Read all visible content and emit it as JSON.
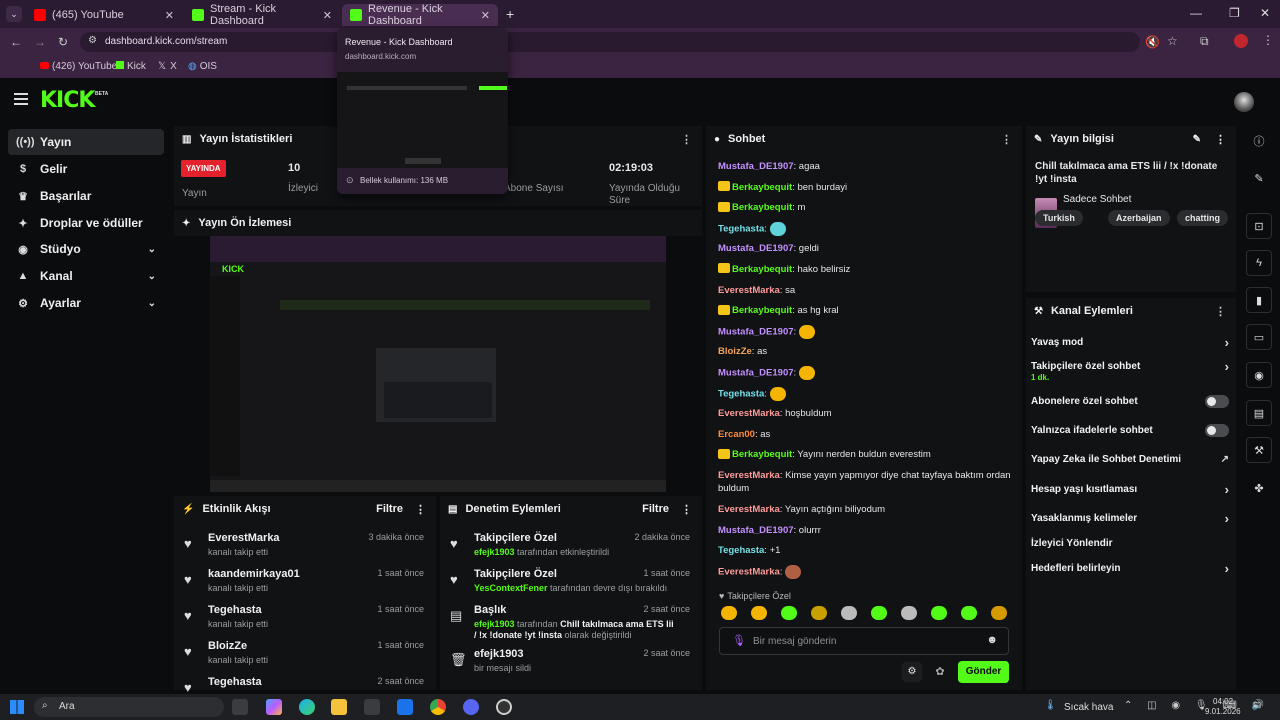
{
  "browser": {
    "tabs": [
      {
        "label": "(465) YouTube",
        "active": false
      },
      {
        "label": "Stream - Kick Dashboard",
        "active": false
      },
      {
        "label": "Revenue - Kick Dashboard",
        "active": true
      }
    ],
    "url": "dashboard.kick.com/stream",
    "bookmarks": [
      "(426) YouTube",
      "Kick",
      "X",
      "OIS"
    ],
    "tooltip": {
      "title": "Revenue - Kick Dashboard",
      "domain": "dashboard.kick.com",
      "memory": "Bellek kullanımı: 136 MB"
    }
  },
  "header": {
    "logo": "KICK",
    "beta": "BETA"
  },
  "sidebar": {
    "items": [
      {
        "label": "Yayın",
        "icon": "broadcast-icon",
        "glyph": "((•))",
        "expandable": false
      },
      {
        "label": "Gelir",
        "icon": "dollar-icon",
        "glyph": "$",
        "expandable": false
      },
      {
        "label": "Başarılar",
        "icon": "trophy-icon",
        "glyph": "♛",
        "expandable": false
      },
      {
        "label": "Droplar ve ödüller",
        "icon": "gift-icon",
        "glyph": "✦",
        "expandable": false
      },
      {
        "label": "Stüdyo",
        "icon": "studio-icon",
        "glyph": "◉",
        "expandable": true
      },
      {
        "label": "Kanal",
        "icon": "channel-icon",
        "glyph": "▲",
        "expandable": true
      },
      {
        "label": "Ayarlar",
        "icon": "settings-icon",
        "glyph": "⚙",
        "expandable": true
      }
    ]
  },
  "stats": {
    "title": "Yayın İstatistikleri",
    "live_badge": "YAYINDA",
    "live_label": "Yayın",
    "viewers_value": "10",
    "viewers_label": "İzleyici",
    "subs_label": "Abone Sayısı",
    "duration_value": "02:19:03",
    "duration_label": "Yayında Olduğu Süre"
  },
  "preview": {
    "title": "Yayın Ön İzlemesi"
  },
  "activity": {
    "title": "Etkinlik Akışı",
    "filter": "Filtre",
    "items": [
      {
        "name": "EverestMarka",
        "sub": "kanalı takip etti",
        "time": "3 dakika önce"
      },
      {
        "name": "kaandemirkaya01",
        "sub": "kanalı takip etti",
        "time": "1 saat önce"
      },
      {
        "name": "Tegehasta",
        "sub": "kanalı takip etti",
        "time": "1 saat önce"
      },
      {
        "name": "BloizZe",
        "sub": "kanalı takip etti",
        "time": "1 saat önce"
      },
      {
        "name": "Tegehasta",
        "sub": "",
        "time": "2 saat önce"
      }
    ]
  },
  "moderation": {
    "title": "Denetim Eylemleri",
    "filter": "Filtre",
    "items": [
      {
        "name": "Takipçilere Özel",
        "user": "efejk1903",
        "rest": " tarafından etkinleştirildi",
        "time": "2 dakika önce"
      },
      {
        "name": "Takipçilere Özel",
        "user": "YesContextFener",
        "rest": " tarafından devre dışı bırakıldı",
        "time": "1 saat önce"
      },
      {
        "name": "Başlık",
        "user": "efejk1903",
        "rest": " tarafından ",
        "title_bold": "Chill takılmaca ama ETS lii / !x !donate !yt !insta",
        "rest2": " olarak değiştirildi",
        "time": "2 saat önce"
      },
      {
        "name": "efejk1903",
        "user": "",
        "rest": "bir mesajı sildi",
        "time": "2 saat önce"
      }
    ]
  },
  "chat": {
    "title": "Sohbet",
    "messages": [
      {
        "user": "Mustafa_DE1907",
        "color": "#c490ff",
        "crown": false,
        "text": "agaa"
      },
      {
        "user": "Berkaybequit",
        "color": "#53fc18",
        "crown": true,
        "text": "ben burdayi"
      },
      {
        "user": "Berkaybequit",
        "color": "#53fc18",
        "crown": true,
        "text": "m"
      },
      {
        "user": "Tegehasta",
        "color": "#74e0e8",
        "crown": false,
        "text": "",
        "emote": "#5fd3d9"
      },
      {
        "user": "Mustafa_DE1907",
        "color": "#c490ff",
        "crown": false,
        "text": "geldi"
      },
      {
        "user": "Berkaybequit",
        "color": "#53fc18",
        "crown": true,
        "text": "hako belirsiz"
      },
      {
        "user": "EverestMarka",
        "color": "#ff9b9b",
        "crown": false,
        "text": "sa"
      },
      {
        "user": "Berkaybequit",
        "color": "#53fc18",
        "crown": true,
        "text": "as hg kral"
      },
      {
        "user": "Mustafa_DE1907",
        "color": "#c490ff",
        "crown": false,
        "text": "",
        "emote": "#f5b400"
      },
      {
        "user": "BloizZe",
        "color": "#f5a35c",
        "crown": false,
        "text": "as"
      },
      {
        "user": "Mustafa_DE1907",
        "color": "#c490ff",
        "crown": false,
        "text": "",
        "emote": "#f5b400"
      },
      {
        "user": "Tegehasta",
        "color": "#74e0e8",
        "crown": false,
        "text": "",
        "emote": "#f5b400"
      },
      {
        "user": "EverestMarka",
        "color": "#ff9b9b",
        "crown": false,
        "text": "hoşbuldum"
      },
      {
        "user": "Ercan00",
        "color": "#ff8a3d",
        "crown": false,
        "text": "as"
      },
      {
        "user": "Berkaybequit",
        "color": "#53fc18",
        "crown": true,
        "text": "Yayını nerden buldun everestim"
      },
      {
        "user": "EverestMarka",
        "color": "#ff9b9b",
        "crown": false,
        "text": "Kimse yayın yapmıyor diye chat tayfaya baktım ordan buldum"
      },
      {
        "user": "EverestMarka",
        "color": "#ff9b9b",
        "crown": false,
        "text": "Yayın açtığını biliyodum"
      },
      {
        "user": "Mustafa_DE1907",
        "color": "#c490ff",
        "crown": false,
        "text": "olurrr"
      },
      {
        "user": "Tegehasta",
        "color": "#74e0e8",
        "crown": false,
        "text": "+1"
      },
      {
        "user": "EverestMarka",
        "color": "#ff9b9b",
        "crown": false,
        "text": "",
        "emote": "#b06040"
      }
    ],
    "mode_label": "Takipçilere Özel",
    "input_placeholder": "Bir mesaj gönderin",
    "send_label": "Gönder"
  },
  "stream_info": {
    "title": "Yayın bilgisi",
    "stream_title": "Chill takılmaca ama ETS lii / !x !donate !yt !insta",
    "category": "Sadece Sohbet",
    "tags": [
      "Turkish",
      "Azerbaijan",
      "chatting"
    ]
  },
  "channel_actions": {
    "title": "Kanal Eylemleri",
    "rows": [
      {
        "label": "Yavaş mod",
        "type": "arrow"
      },
      {
        "label": "Takipçilere özel sohbet",
        "sub": "1 dk.",
        "type": "arrow"
      },
      {
        "label": "Abonelere özel sohbet",
        "type": "toggle"
      },
      {
        "label": "Yalnızca ifadelerle sohbet",
        "type": "toggle"
      },
      {
        "label": "Yapay Zeka ile Sohbet Denetimi",
        "type": "external"
      },
      {
        "label": "Hesap yaşı kısıtlaması",
        "type": "arrow"
      },
      {
        "label": "Yasaklanmış kelimeler",
        "type": "arrow"
      },
      {
        "label": "İzleyici Yönlendir",
        "type": "none"
      },
      {
        "label": "Hedefleri belirleyin",
        "type": "arrow"
      }
    ]
  },
  "taskbar": {
    "search": "Ara",
    "weather": "Sıcak hava",
    "time": "04:02",
    "date": "9.01.2026"
  },
  "colors": {
    "brand": "#53fc18",
    "live": "#e5212b"
  }
}
